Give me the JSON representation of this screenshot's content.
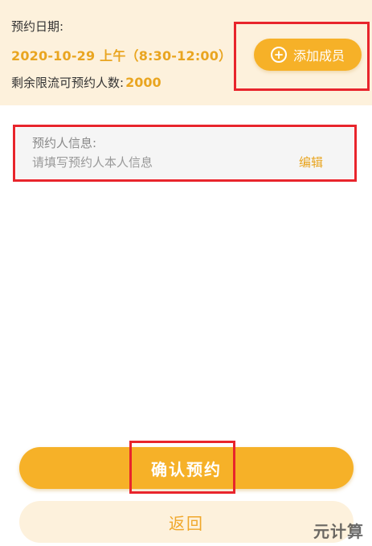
{
  "booking": {
    "date_label": "预约日期:",
    "date_value": "2020-10-29 上午（8:30-12:00）",
    "remaining_label": "剩余限流可预约人数:",
    "remaining_count": "2000"
  },
  "add_member": {
    "label": "添加成员",
    "icon": "plus-circle-icon"
  },
  "booker_info": {
    "title": "预约人信息:",
    "placeholder": "请填写预约人本人信息",
    "edit_label": "编辑"
  },
  "actions": {
    "confirm_label": "确认预约",
    "back_label": "返回"
  },
  "watermark": "元计算",
  "colors": {
    "accent": "#f6b128",
    "accent_text": "#e9a520",
    "panel_bg": "#fdf1dc",
    "highlight": "#e8252c"
  }
}
